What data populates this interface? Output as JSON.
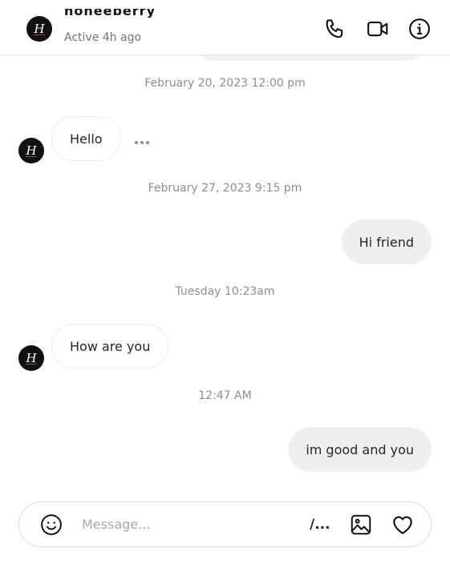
{
  "header": {
    "avatar_letter": "H",
    "name": "honeeberry",
    "status": "Active 4h ago",
    "icons": [
      "phone-icon",
      "video-camera-icon",
      "info-icon"
    ]
  },
  "conversation": {
    "timestamps": [
      "February 20, 2023 12:00 pm",
      "February 27, 2023 9:15 pm",
      "Tuesday 10:23am",
      "12:47 AM"
    ],
    "messages": [
      {
        "direction": "incoming",
        "text": "Hello"
      },
      {
        "direction": "outgoing",
        "text": "Hi friend"
      },
      {
        "direction": "incoming",
        "text": "How are you"
      },
      {
        "direction": "outgoing",
        "text": "im good and you"
      }
    ],
    "avatar_letter": "H"
  },
  "composer": {
    "placeholder": "Message...",
    "command_label": "/...",
    "icons": [
      "emoji-icon",
      "image-icon",
      "heart-icon"
    ]
  },
  "colors": {
    "incoming_bubble": "#ffffff",
    "outgoing_bubble": "#efefef",
    "timestamp_text": "#8e8e8e",
    "avatar_bg": "#111111"
  }
}
